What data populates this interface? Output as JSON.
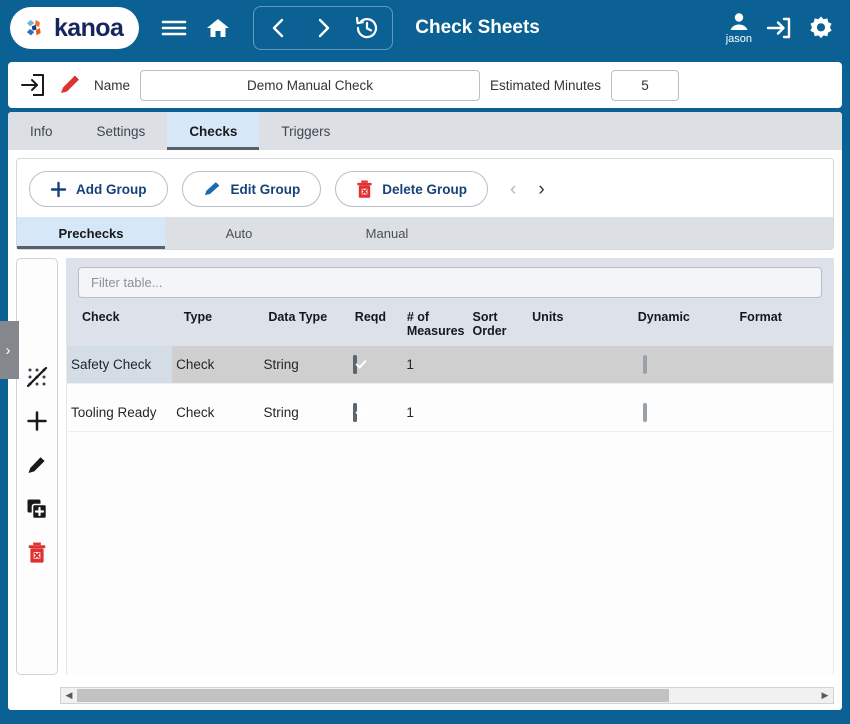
{
  "theme": {
    "brand_blue": "#0b6194",
    "accent_navy": "#15427a",
    "danger_red": "#e03131",
    "logo_navy": "#16265c",
    "logo_orange": "#f0712a"
  },
  "header": {
    "brand": "kanoa",
    "title": "Check Sheets",
    "icons": {
      "menu": "hamburger-icon",
      "home": "home-icon",
      "back": "chevron-left-icon",
      "forward": "chevron-right-icon",
      "history": "history-clock-icon",
      "user": "user-icon",
      "login": "login-arrow-icon",
      "settings": "gear-icon"
    },
    "user_name": "jason"
  },
  "namebar": {
    "enter_icon": "enter-box-icon",
    "edit_icon": "pencil-icon",
    "name_label": "Name",
    "name_value": "Demo Manual Check",
    "minutes_label": "Estimated Minutes",
    "minutes_value": "5"
  },
  "tabs": [
    {
      "label": "Info",
      "active": false
    },
    {
      "label": "Settings",
      "active": false
    },
    {
      "label": "Checks",
      "active": true
    },
    {
      "label": "Triggers",
      "active": false
    }
  ],
  "toolbar": {
    "add_group": "Add Group",
    "edit_group": "Edit Group",
    "delete_group": "Delete Group",
    "prev_chevron": "‹",
    "next_chevron": "›"
  },
  "subtabs": [
    {
      "label": "Prechecks",
      "active": true
    },
    {
      "label": "Auto",
      "active": false
    },
    {
      "label": "Manual",
      "active": false
    }
  ],
  "rail": {
    "handle_chevron": "›",
    "icons": [
      "drag-disabled-icon",
      "add-icon",
      "edit-pencil-icon",
      "duplicate-icon",
      "delete-trash-icon"
    ]
  },
  "table": {
    "filter_placeholder": "Filter table...",
    "columns": [
      "Check",
      "Type",
      "Data Type",
      "Reqd",
      "# of Measures",
      "Sort Order",
      "Units",
      "Dynamic",
      "Format"
    ],
    "rows": [
      {
        "check": "Safety Check",
        "type": "Check",
        "data_type": "String",
        "reqd": true,
        "measures": "1",
        "sort_order": "",
        "units": "",
        "dynamic": false,
        "format": "",
        "selected": true
      },
      {
        "check": "Tooling Ready",
        "type": "Check",
        "data_type": "String",
        "reqd": true,
        "measures": "1",
        "sort_order": "",
        "units": "",
        "dynamic": false,
        "format": "",
        "selected": false
      }
    ]
  },
  "scrollbar": {
    "left_arrow": "◀",
    "right_arrow": "▶",
    "thumb_pct": "80%"
  }
}
